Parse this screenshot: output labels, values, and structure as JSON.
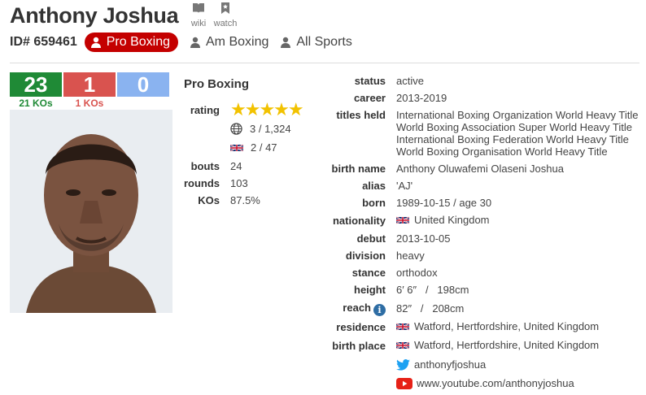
{
  "header": {
    "name": "Anthony Joshua",
    "wiki_label": "wiki",
    "watch_label": "watch",
    "id_text": "ID# 659461",
    "tabs": [
      {
        "label": "Pro Boxing",
        "active": true
      },
      {
        "label": "Am Boxing",
        "active": false
      },
      {
        "label": "All Sports",
        "active": false
      }
    ]
  },
  "record": {
    "wins": "23",
    "losses": "1",
    "draws": "0",
    "wins_kos": "21 KOs",
    "losses_kos": "1 KOs",
    "colors": {
      "win": "#1f8a36",
      "loss": "#d9534f",
      "draw": "#8ab3f0"
    }
  },
  "pro": {
    "section_title": "Pro Boxing",
    "rating_label": "rating",
    "stars": 5,
    "world_rank": "3 / 1,324",
    "uk_rank": "2 / 47",
    "bouts_label": "bouts",
    "bouts": "24",
    "rounds_label": "rounds",
    "rounds": "103",
    "kos_label": "KOs",
    "kos_pct": "87.5%"
  },
  "details": [
    {
      "label": "status",
      "value": "active"
    },
    {
      "label": "career",
      "value": "2013-2019"
    },
    {
      "label": "titles held",
      "values": [
        "International Boxing Organization World Heavy Title",
        "World Boxing Association Super World Heavy Title",
        "International Boxing Federation World Heavy Title",
        "World Boxing Organisation World Heavy Title"
      ]
    },
    {
      "label": "birth name",
      "value": "Anthony Oluwafemi Olaseni Joshua"
    },
    {
      "label": "alias",
      "value": "'AJ'"
    },
    {
      "label": "born",
      "value": "1989-10-15 / age 30"
    },
    {
      "label": "nationality",
      "value": "United Kingdom",
      "icon": "uk-flag-icon"
    },
    {
      "label": "debut",
      "value": "2013-10-05"
    },
    {
      "label": "division",
      "value": "heavy"
    },
    {
      "label": "stance",
      "value": "orthodox"
    },
    {
      "label": "height",
      "value": "6′ 6″   /   198cm"
    },
    {
      "label": "reach",
      "value": "82″   /   208cm",
      "icon": "info-icon"
    },
    {
      "label": "residence",
      "value": "Watford, Hertfordshire, United Kingdom",
      "icon": "uk-flag-icon"
    },
    {
      "label": "birth place",
      "value": "Watford, Hertfordshire, United Kingdom",
      "icon": "uk-flag-icon"
    }
  ],
  "social": {
    "twitter": "anthonyfjoshua",
    "youtube": "www.youtube.com/anthonyjoshua"
  }
}
